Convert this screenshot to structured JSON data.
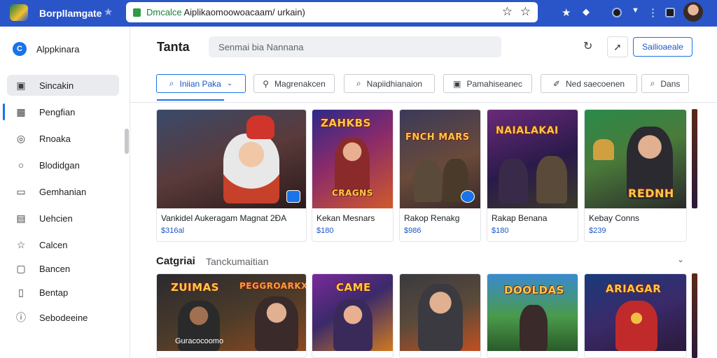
{
  "browser": {
    "app_title": "Borpllamgate",
    "url_prefix": "Dmcalce",
    "url_rest": " Aiplikaomoowoacaam/ urkain)"
  },
  "sidebar": {
    "header": "Alppkinara",
    "items": [
      {
        "label": "Sincakin",
        "icon": "bookmark-icon"
      },
      {
        "label": "Pengfian",
        "icon": "calendar-icon"
      },
      {
        "label": "Rnoaka",
        "icon": "chat-icon"
      },
      {
        "label": "Blodidgan",
        "icon": "speech-bubble-icon"
      },
      {
        "label": "Gemhanian",
        "icon": "window-icon"
      },
      {
        "label": "Uehcien",
        "icon": "clipboard-icon"
      },
      {
        "label": "Calcen",
        "icon": "star-icon"
      },
      {
        "label": "Bancen",
        "icon": "list-icon"
      },
      {
        "label": "Bentap",
        "icon": "document-icon"
      },
      {
        "label": "Sebodeeine",
        "icon": "info-icon"
      }
    ]
  },
  "header": {
    "title": "Tanta",
    "search_placeholder": "Senmai bia Nannana",
    "action_button": "Sailioaeale"
  },
  "filters": [
    {
      "label": "Iniian Paka",
      "icon": "search-icon",
      "selected": true
    },
    {
      "label": "Magrenakcen",
      "icon": "pin-icon",
      "selected": false
    },
    {
      "label": "Napiidhianaion",
      "icon": "search-icon",
      "selected": false
    },
    {
      "label": "Pamahiseanec",
      "icon": "image-icon",
      "selected": false
    },
    {
      "label": "Ned saecoenen",
      "icon": "brush-icon",
      "selected": false
    },
    {
      "label": "Dans",
      "icon": "search-icon",
      "selected": false
    }
  ],
  "cards_row1": [
    {
      "title": "Vankidel Aukeragam Magnat 2ÐA",
      "price": "$316al",
      "art_text": "",
      "colors": [
        "#3a2a40",
        "#c7402a"
      ]
    },
    {
      "title": "Kekan Mesnars",
      "price": "$180",
      "art_text": "ZAHKBS",
      "colors": [
        "#2a1a6a",
        "#c0402a"
      ]
    },
    {
      "title": "Rakop Renakg",
      "price": "$986",
      "art_text": "FNCH MARS",
      "colors": [
        "#3a2a55",
        "#8a5a3a"
      ]
    },
    {
      "title": "Rakap Benana",
      "price": "$180",
      "art_text": "NAIALAKAI",
      "colors": [
        "#3a1a4a",
        "#b0406a"
      ]
    },
    {
      "title": "Kebay Conns",
      "price": "$239",
      "art_text": "REDNH",
      "colors": [
        "#2a5a3a",
        "#c07030"
      ]
    }
  ],
  "section": {
    "title": "Catgriai",
    "subtitle": "Tanckumaitian"
  },
  "cards_row2": [
    {
      "art_text": "ZUIMAS",
      "caption": "Guracocoomo",
      "colors": [
        "#2a2a30",
        "#8a4020"
      ]
    },
    {
      "art_text": "CAME",
      "caption": "",
      "colors": [
        "#5a1a6a",
        "#d06020"
      ]
    },
    {
      "art_text": "",
      "caption": "",
      "colors": [
        "#3a3a40",
        "#c05020"
      ]
    },
    {
      "art_text": "DOOLDAS",
      "caption": "",
      "colors": [
        "#2a6a3a",
        "#c0a030"
      ]
    },
    {
      "art_text": "ARIAGAR",
      "caption": "",
      "colors": [
        "#1a3a7a",
        "#c02a2a"
      ]
    }
  ],
  "colors": {
    "accent": "#1a73e8",
    "topbar": "#2a55c8"
  }
}
